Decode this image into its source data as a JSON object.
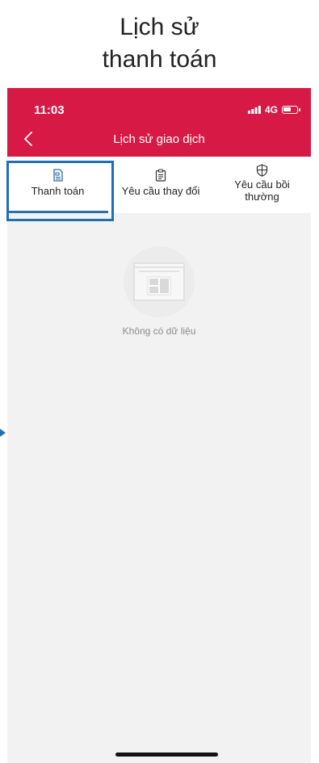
{
  "caption": {
    "line1": "Lịch sử",
    "line2": "thanh toán"
  },
  "status": {
    "time": "11:03",
    "signal": "4G"
  },
  "header": {
    "title": "Lịch sử giao dịch"
  },
  "tabs": [
    {
      "label": "Thanh toán",
      "icon": "payment-document-icon",
      "active": true
    },
    {
      "label": "Yêu cầu thay đổi",
      "icon": "clipboard-icon",
      "active": false
    },
    {
      "label_line1": "Yêu cầu bồi",
      "label_line2": "thường",
      "icon": "shield-icon",
      "active": false
    }
  ],
  "empty_state": {
    "text": "Không có dữ liệu",
    "icon": "empty-document-icon"
  },
  "colors": {
    "appbar": "#d71a45",
    "highlight": "#1f6fb2",
    "tab_indicator": "#2e6fa8"
  }
}
